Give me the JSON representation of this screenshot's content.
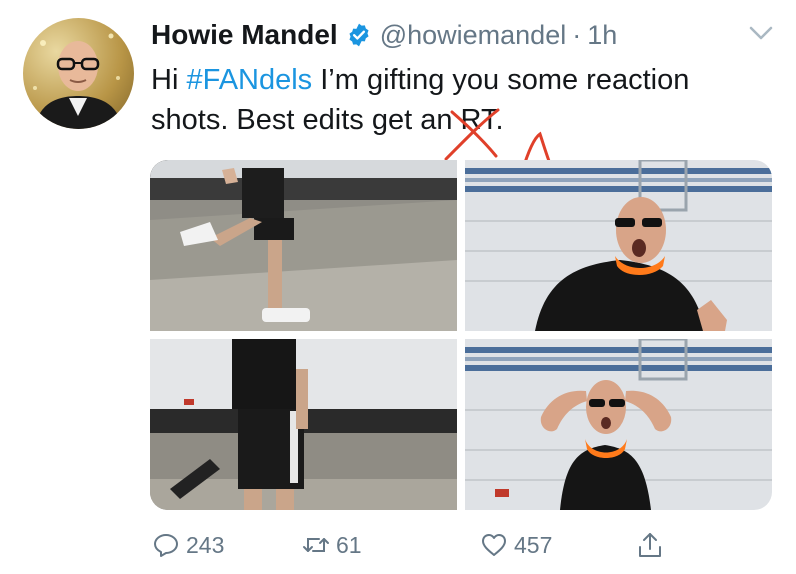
{
  "tweet": {
    "author_name": "Howie Mandel",
    "handle": "@howiemandel",
    "time_separator": "·",
    "time": "1h",
    "text_line1_prefix": "Hi ",
    "hashtag": "#FANdels",
    "text_line1_suffix": " I’m gifting you some reaction",
    "text_line2_prefix": "shots. Best edits get ",
    "struck_word": "an",
    "text_line2_suffix": " RT.",
    "handwritten_correction": "A"
  },
  "actions": {
    "reply_count": "243",
    "retweet_count": "61",
    "like_count": "457"
  },
  "colors": {
    "link": "#1b95e0",
    "muted": "#657786",
    "correction": "#e0402a"
  },
  "icons": [
    "verified-badge-icon",
    "chevron-down-icon",
    "reply-icon",
    "retweet-icon",
    "like-icon",
    "share-icon"
  ]
}
